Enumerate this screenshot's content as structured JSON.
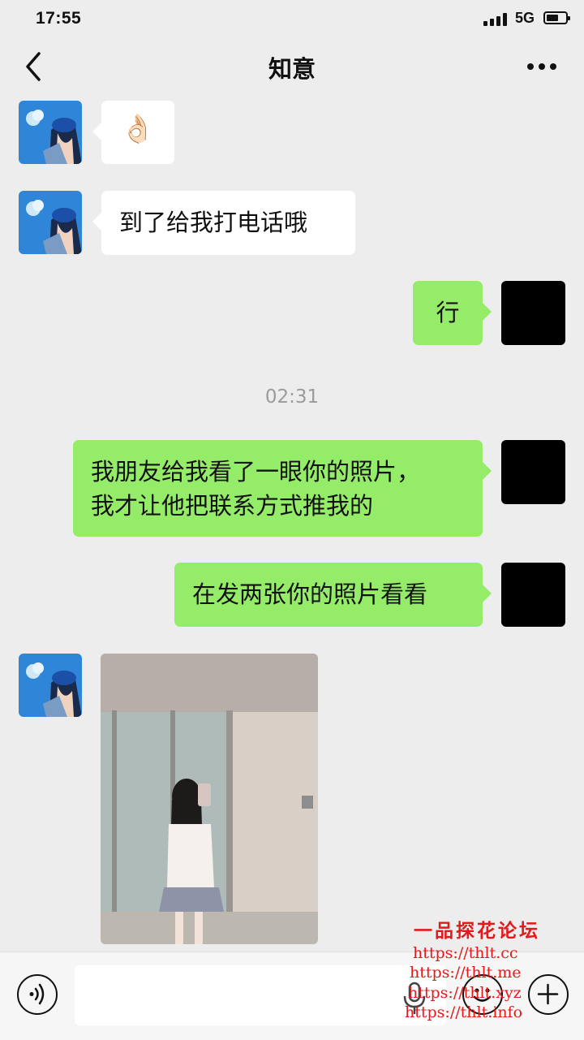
{
  "status_bar": {
    "time": "17:55",
    "network": "5G"
  },
  "nav": {
    "title": "知意"
  },
  "messages": {
    "m1_emoji": "👌🏻",
    "m2_text": "到了给我打电话哦",
    "m3_text": "行",
    "timestamp": "02:31",
    "m4_line1": "我朋友给我看了一眼你的照片，",
    "m4_line2": "我才让他把联系方式推我的",
    "m5_text": "在发两张你的照片看看"
  },
  "watermark": {
    "title": "一品探花论坛",
    "links": [
      "https://thlt.cc",
      "https://thlt.me",
      "https://thlt.xyz",
      "https://thlt.info"
    ]
  },
  "colors": {
    "sent_bubble": "#95ec69",
    "received_bubble": "#ffffff",
    "background": "#ededed",
    "watermark": "#e4191b"
  }
}
